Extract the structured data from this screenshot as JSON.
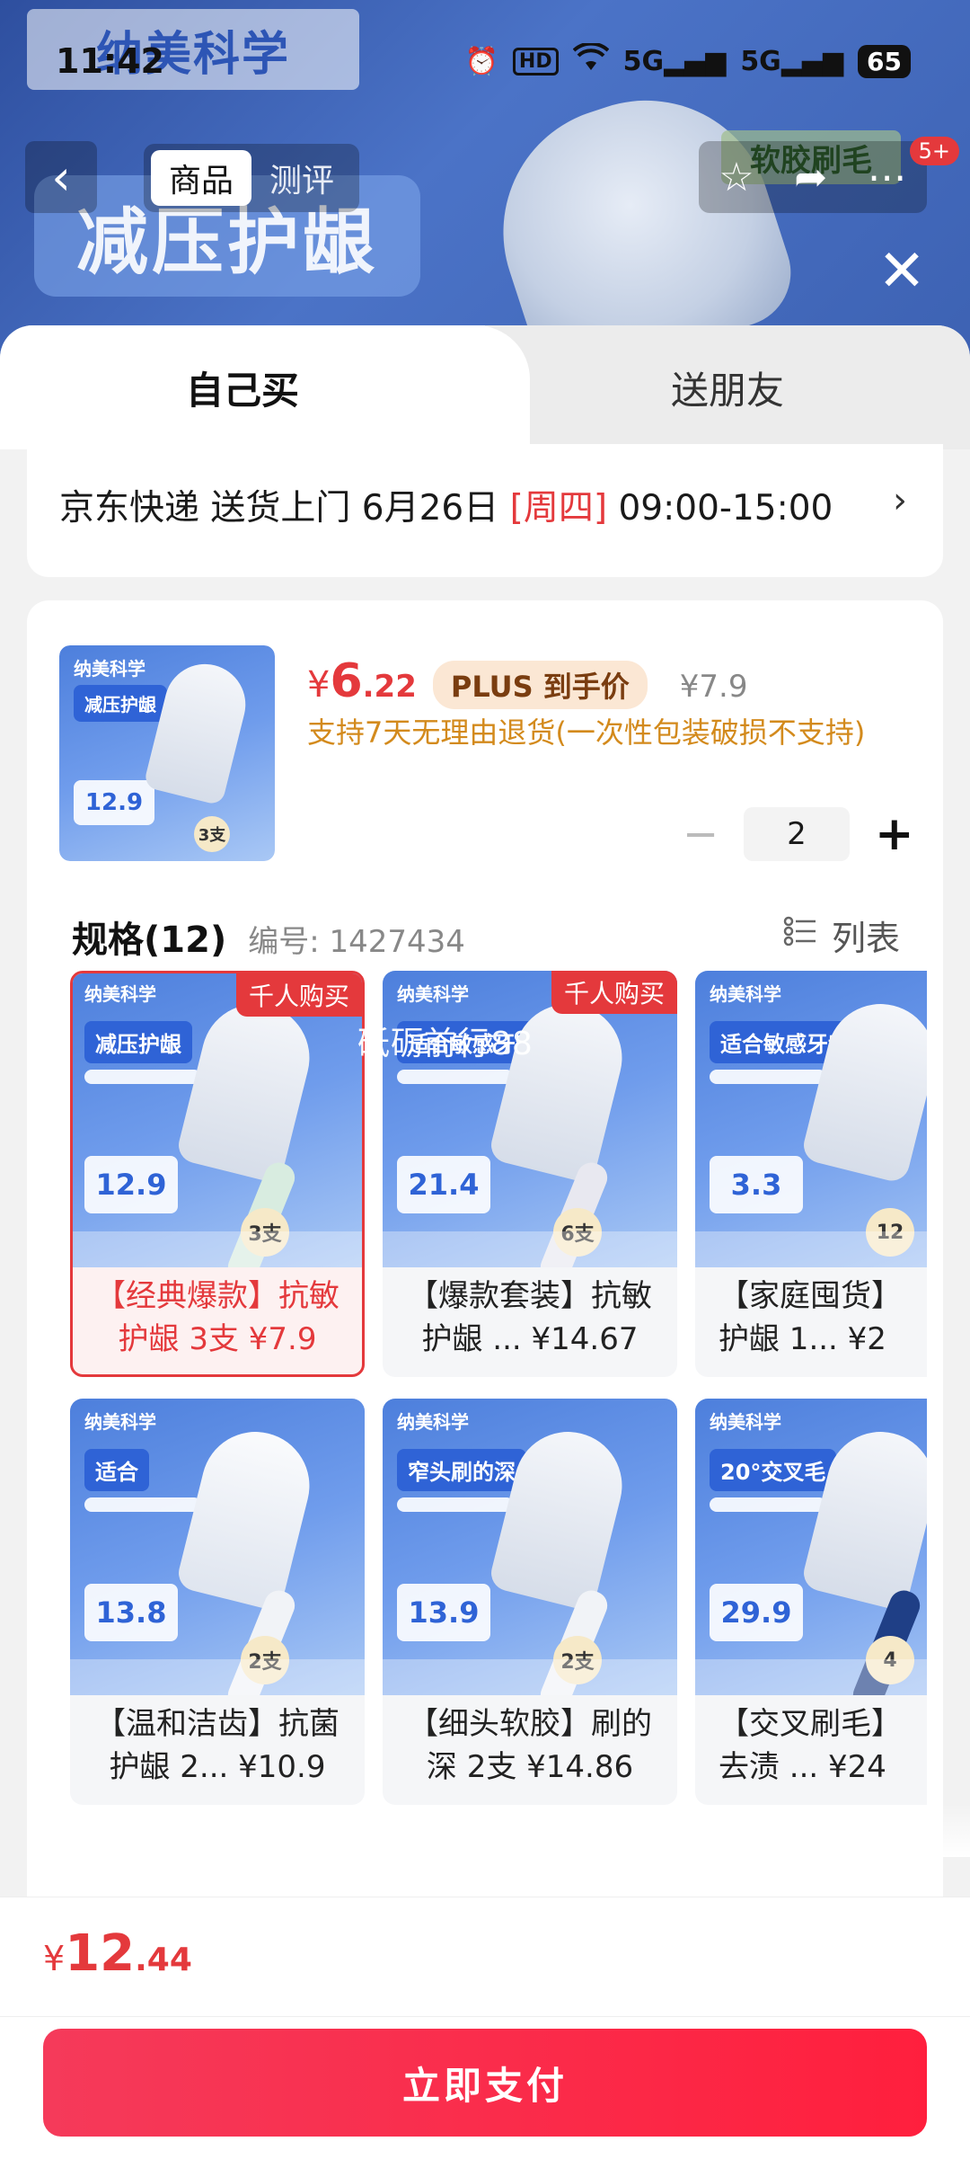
{
  "status_bar": {
    "time": "11:42",
    "network": "5G",
    "battery": "65"
  },
  "background": {
    "brand": "纳美科学",
    "title": "减压护龈",
    "soft_bristle": "软胶刷毛"
  },
  "nav": {
    "back_icon": "chevron-left-icon",
    "tabs": [
      "商品",
      "测评"
    ],
    "badge": "5+"
  },
  "sheet": {
    "tabs": [
      "自己买",
      "送朋友"
    ],
    "delivery": {
      "carrier": "京东快递 送货上门 6月26日",
      "weekday": "[周四]",
      "time": "09:00-15:00"
    }
  },
  "product": {
    "price_currency": "¥",
    "price_int": "6",
    "price_dec": ".22",
    "plus_tag": "PLUS 到手价",
    "original_price": "¥7.9",
    "return_note": "支持7天无理由退货(一次性包装破损不支持)",
    "quantity": "2"
  },
  "specs": {
    "title": "规格(12)",
    "number": "编号: 1427434",
    "list_label": "列表",
    "items": [
      {
        "caption_line1": "【经典爆款】抗敏",
        "caption_line2": "护龈 3支 ¥7.9",
        "hot": "千人购买",
        "img_title": "减压护龈",
        "img_price": "12.9",
        "img_count": "3支",
        "selected": true
      },
      {
        "caption_line1": "【爆款套装】抗敏",
        "caption_line2": "护龈 ... ¥14.67",
        "hot": "千人购买",
        "img_title": "适合敏感牙龈",
        "img_price": "21.4",
        "img_count": "6支",
        "selected": false
      },
      {
        "caption_line1": "【家庭囤货】",
        "caption_line2": "护龈 1... ¥2",
        "hot": "",
        "img_title": "适合敏感牙龈",
        "img_price": "3.3",
        "img_count": "12",
        "selected": false
      },
      {
        "caption_line1": "【温和洁齿】抗菌",
        "caption_line2": "护龈 2... ¥10.9",
        "hot": "",
        "img_title": "适合",
        "img_price": "13.8",
        "img_count": "2支",
        "selected": false
      },
      {
        "caption_line1": "【细头软胶】刷的",
        "caption_line2": "深 2支 ¥14.86",
        "hot": "",
        "img_title": "窄头刷的深",
        "img_price": "13.9",
        "img_count": "2支",
        "selected": false
      },
      {
        "caption_line1": "【交叉刷毛】",
        "caption_line2": "去渍 ... ¥24",
        "hot": "",
        "img_title": "20°交叉毛",
        "img_price": "29.9",
        "img_count": "4",
        "selected": false
      }
    ],
    "watermark": "砥砺前行88"
  },
  "footer": {
    "total_currency": "¥",
    "total_int": "12",
    "total_dec": ".44",
    "pay_label": "立即支付"
  },
  "colors": {
    "accent_red": "#e4393c",
    "pay_button": "#ff1f3d",
    "plus_bg": "#fbe7d4",
    "return_note": "#d38a1c"
  }
}
